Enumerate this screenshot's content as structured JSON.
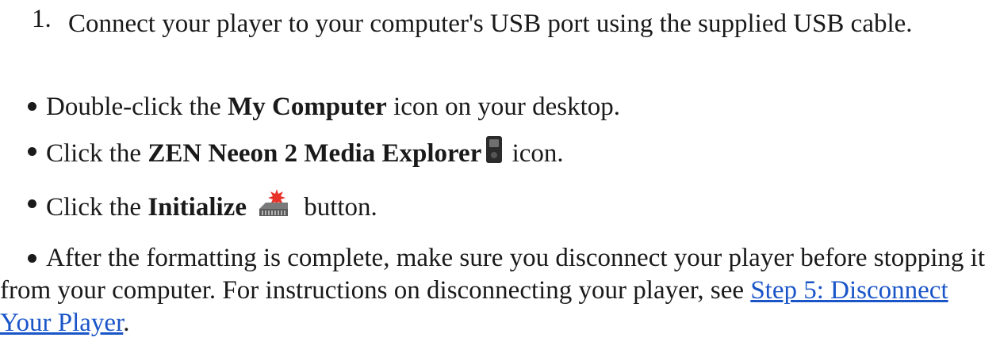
{
  "step1": {
    "number": "1.",
    "text": "Connect your player to your computer's USB port using the supplied USB cable."
  },
  "bullet1": {
    "pre": "Double-click the ",
    "bold": "My Computer",
    "post": " icon on your desktop."
  },
  "bullet2": {
    "pre": "Click the ",
    "bold": "ZEN Neeon 2 Media Explorer",
    "post": " icon.",
    "icon": "media-player-icon"
  },
  "bullet3": {
    "pre": "Click the ",
    "bold": "Initialize",
    "post": " button.",
    "icon": "initialize-icon"
  },
  "bullet4": {
    "text": "After the formatting is complete, make sure you disconnect your player before stopping it from your computer. For instructions on disconnecting your player, see ",
    "link": "Step 5: Disconnect Your Player",
    "end": "."
  },
  "colors": {
    "link": "#1a55c8",
    "text": "#1a1a1a"
  }
}
